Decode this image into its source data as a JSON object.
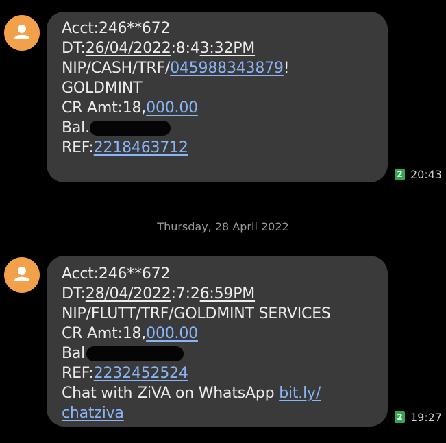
{
  "messages": [
    {
      "acct": "Acct:246**672",
      "dt_prefix": "DT:",
      "dt_date": "26/04/2022",
      "dt_time_a": ":8:4",
      "dt_time_b": "3:32PM",
      "nip_prefix": "NIP/CASH/TRF/",
      "nip_link": "045988343879",
      "nip_suffix": "!",
      "line4": "GOLDMINT",
      "cr_prefix": "CR Amt:18,",
      "cr_link": "000.00",
      "bal_label": "Bal.",
      "ref_prefix": "REF:",
      "ref_link": "2218463712",
      "sim": "2",
      "time": "20:43"
    },
    {
      "acct": "Acct:246**672",
      "dt_prefix": "DT:",
      "dt_date": "28/04/2022",
      "dt_time_a": ":7:2",
      "dt_time_b": "6:59PM",
      "nip_full": "NIP/FLUTT/TRF/GOLDMINT SERVICES",
      "cr_prefix": "CR Amt:18,",
      "cr_link": "000.00",
      "bal_label": "Bal",
      "ref_prefix": "REF:",
      "ref_link": "2232452524",
      "chat_prefix": "Chat with ZiVA on WhatsApp ",
      "chat_link_a": "bit.ly/",
      "chat_link_b": "chatziva",
      "sim": "2",
      "time": "19:27"
    }
  ],
  "date_separator": "Thursday, 28 April 2022",
  "colors": {
    "background": "#000000",
    "bubble": "#3a3a3a",
    "link": "#8ab4f8",
    "avatar": "#f2a04a",
    "sim_badge": "#2fa84f"
  },
  "icons": {
    "avatar": "person-icon",
    "sim": "sim-2-icon"
  }
}
